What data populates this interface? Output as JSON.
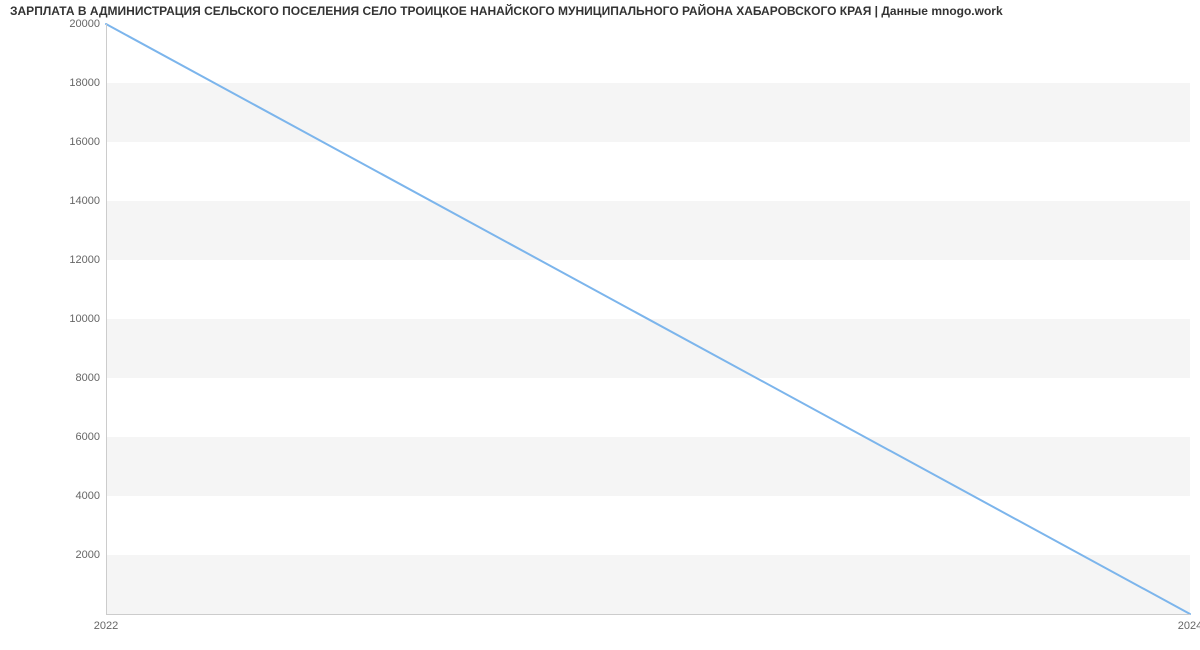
{
  "chart_data": {
    "type": "line",
    "title": "ЗАРПЛАТА В АДМИНИСТРАЦИЯ СЕЛЬСКОГО ПОСЕЛЕНИЯ СЕЛО ТРОИЦКОЕ НАНАЙСКОГО МУНИЦИПАЛЬНОГО РАЙОНА ХАБАРОВСКОГО КРАЯ | Данные mnogo.work",
    "x": [
      2022,
      2024
    ],
    "values": [
      20000,
      0
    ],
    "xlabel": "",
    "ylabel": "",
    "x_ticks": [
      2022,
      2024
    ],
    "y_ticks": [
      2000,
      4000,
      6000,
      8000,
      10000,
      12000,
      14000,
      16000,
      18000,
      20000
    ],
    "xlim": [
      2022,
      2024
    ],
    "ylim": [
      0,
      20000
    ],
    "line_color": "#7cb5ec",
    "grid": "banded"
  }
}
